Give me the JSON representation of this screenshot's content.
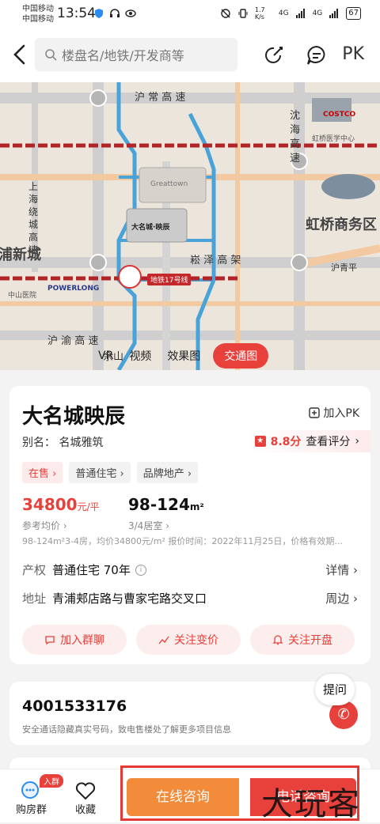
{
  "status_bar": {
    "carrier_1": "中国移动",
    "carrier_2": "中国移动",
    "time": "13:54",
    "speed": "1.7 K/s",
    "signal_1": "4G",
    "signal_2": "4G",
    "battery": "67"
  },
  "nav": {
    "search_placeholder": "楼盘名/地铁/开发商等",
    "pk_label": "PK"
  },
  "map": {
    "tabs": [
      {
        "label": "VR",
        "active": false
      },
      {
        "label": "视频",
        "active": false
      },
      {
        "label": "效果图",
        "active": false
      },
      {
        "label": "交通图",
        "active": true
      }
    ],
    "road_labels": {
      "hu_chang": "沪 常 高 速",
      "song_ze": "崧 泽 高 架",
      "hu_yu": "沪 渝 高 速",
      "hu_qing_ping": "沪青平",
      "shen_hai": "沈 海 高 速",
      "shang_hai_rao_cheng": "上 海 绕 城 高 速"
    },
    "area_labels": {
      "hong_qiao_business": "虹桥商务区",
      "pu_xin_cheng": "浦新城",
      "metro_17": "地铁17号线",
      "she_shan": "佘山"
    },
    "poi_labels": {
      "costco": "COSTCO",
      "great_town": "Greattown",
      "da_ming_cheng": "大名城·映辰",
      "powerlong": "POWERLONG",
      "hongqiao_hospital": "虹桥医学中心",
      "zhongshan_hospital": "中山医院"
    }
  },
  "property": {
    "title": "大名城映辰",
    "add_pk": "加入PK",
    "alias_label": "别名：",
    "alias_value": "名城雅筑",
    "rating_score": "8.8分",
    "rating_link": "查看评分",
    "tags": [
      "在售",
      "普通住宅",
      "品牌地产"
    ],
    "price": "34800",
    "price_unit": "元/平",
    "price_label": "参考均价",
    "area": "98-124",
    "area_unit": "m²",
    "area_label": "3/4居室",
    "summary": "98-124m²3-4房，均价34800元/m²  报价时间：2022年11月25日，价格有效期...",
    "property_right_key": "产权",
    "property_right_value": "普通住宅 70年",
    "property_right_link": "详情",
    "address_key": "地址",
    "address_value": "青浦郏店路与曹家宅路交叉口",
    "address_link": "周边",
    "actions": [
      "加入群聊",
      "关注变价",
      "关注开盘"
    ]
  },
  "phone": {
    "number": "4001533176",
    "note": "安全通话隐藏真实号码，致电售楼处了解更多项目信息",
    "ask": "提问"
  },
  "bottom_bar": {
    "group_badge": "入群",
    "group_label": "购房群",
    "fav_label": "收藏",
    "online_consult": "在线咨询",
    "phone_consult": "电话咨询",
    "watermark": "大玩客"
  },
  "colors": {
    "accent_red": "#e8403b",
    "accent_orange": "#f28b3a"
  }
}
